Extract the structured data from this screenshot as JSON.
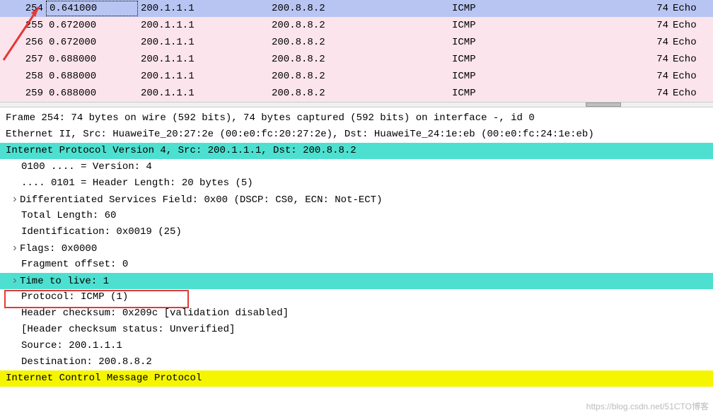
{
  "packets": [
    {
      "no": "254",
      "time": "0.641000",
      "src": "200.1.1.1",
      "dst": "200.8.8.2",
      "proto": "ICMP",
      "len": "74",
      "info": "Echo",
      "selected": true
    },
    {
      "no": "255",
      "time": "0.672000",
      "src": "200.1.1.1",
      "dst": "200.8.8.2",
      "proto": "ICMP",
      "len": "74",
      "info": "Echo",
      "selected": false
    },
    {
      "no": "256",
      "time": "0.672000",
      "src": "200.1.1.1",
      "dst": "200.8.8.2",
      "proto": "ICMP",
      "len": "74",
      "info": "Echo",
      "selected": false
    },
    {
      "no": "257",
      "time": "0.688000",
      "src": "200.1.1.1",
      "dst": "200.8.8.2",
      "proto": "ICMP",
      "len": "74",
      "info": "Echo",
      "selected": false
    },
    {
      "no": "258",
      "time": "0.688000",
      "src": "200.1.1.1",
      "dst": "200.8.8.2",
      "proto": "ICMP",
      "len": "74",
      "info": "Echo",
      "selected": false
    },
    {
      "no": "259",
      "time": "0.688000",
      "src": "200.1.1.1",
      "dst": "200.8.8.2",
      "proto": "ICMP",
      "len": "74",
      "info": "Echo",
      "selected": false
    }
  ],
  "detail": {
    "frame": "Frame 254: 74 bytes on wire (592 bits), 74 bytes captured (592 bits) on interface -, id 0",
    "ethernet": "Ethernet II, Src: HuaweiTe_20:27:2e (00:e0:fc:20:27:2e), Dst: HuaweiTe_24:1e:eb (00:e0:fc:24:1e:eb)",
    "ip_header": "Internet Protocol Version 4, Src: 200.1.1.1, Dst: 200.8.8.2",
    "version": "0100 .... = Version: 4",
    "hdrlen": ".... 0101 = Header Length: 20 bytes (5)",
    "dscp": "Differentiated Services Field: 0x00 (DSCP: CS0, ECN: Not-ECT)",
    "totlen": "Total Length: 60",
    "ident": "Identification: 0x0019 (25)",
    "flags": "Flags: 0x0000",
    "fragoff": "Fragment offset: 0",
    "ttl": "Time to live: 1",
    "protocol": "Protocol: ICMP (1)",
    "checksum": "Header checksum: 0x209c [validation disabled]",
    "checksum_status": "[Header checksum status: Unverified]",
    "source": "Source: 200.1.1.1",
    "destination": "Destination: 200.8.8.2",
    "icmp": "Internet Control Message Protocol"
  },
  "watermark": "https://blog.csdn.net/51CTO博客"
}
